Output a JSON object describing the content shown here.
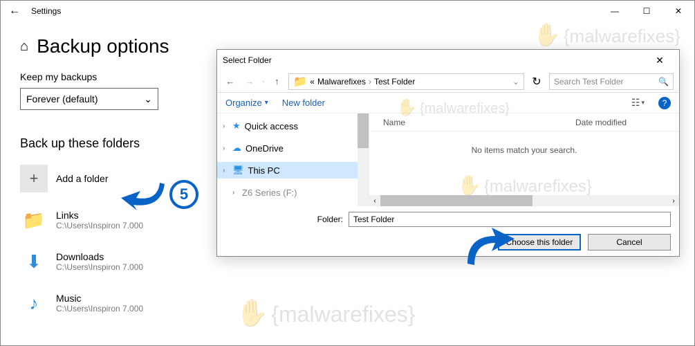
{
  "titlebar": {
    "app_name": "Settings"
  },
  "page": {
    "title": "Backup options"
  },
  "keep": {
    "label": "Keep my backups",
    "value": "Forever (default)"
  },
  "backup": {
    "section": "Back up these folders",
    "add": "Add a folder",
    "folders": [
      {
        "name": "Links",
        "path": "C:\\Users\\Inspiron 7.000"
      },
      {
        "name": "Downloads",
        "path": "C:\\Users\\Inspiron 7.000"
      },
      {
        "name": "Music",
        "path": "C:\\Users\\Inspiron 7.000"
      }
    ]
  },
  "dialog": {
    "title": "Select Folder",
    "crumb_prefix": "«",
    "crumbs": [
      "Malwarefixes",
      "Test Folder"
    ],
    "search_placeholder": "Search Test Folder",
    "organize": "Organize",
    "newfolder": "New folder",
    "columns": {
      "name": "Name",
      "date": "Date modified"
    },
    "empty": "No items match your search.",
    "tree": {
      "quickaccess": "Quick access",
      "onedrive": "OneDrive",
      "thispc": "This PC",
      "disk": "Z6 Series (F:)"
    },
    "folder_label": "Folder:",
    "folder_value": "Test Folder",
    "choose": "Choose this folder",
    "cancel": "Cancel"
  },
  "callout": {
    "num": "5"
  },
  "watermark": "malwarefixes"
}
